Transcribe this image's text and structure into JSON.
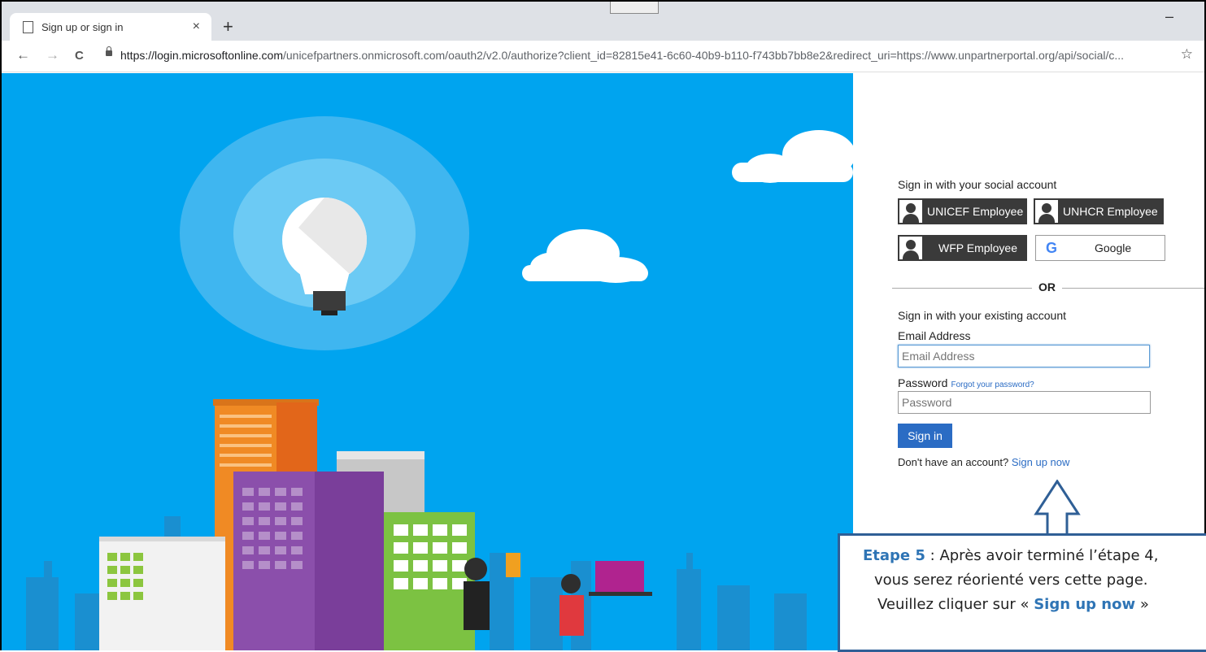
{
  "browser": {
    "tab_title": "Sign up or sign in",
    "tab_close": "×",
    "new_tab": "+",
    "minimize": "–",
    "back": "←",
    "forward": "→",
    "reload": "C",
    "url_host": "https://login.microsoftonline.com",
    "url_rest": "/unicefpartners.onmicrosoft.com/oauth2/v2.0/authorize?client_id=82815e41-6c60-40b9-b110-f743bb7bb8e2&redirect_uri=https://www.unpartnerportal.org/api/social/c...",
    "star": "☆"
  },
  "signin": {
    "social_title": "Sign in with your social account",
    "social_buttons": [
      {
        "label": "UNICEF Employee",
        "icon": "person-icon"
      },
      {
        "label": "UNHCR Employee",
        "icon": "person-icon"
      },
      {
        "label": "WFP Employee",
        "icon": "person-icon"
      },
      {
        "label": "Google",
        "icon": "google-g-icon"
      }
    ],
    "google_glyph": "G",
    "or_label": "OR",
    "existing_title": "Sign in with your existing account",
    "email_label": "Email Address",
    "email_placeholder": "Email Address",
    "password_label": "Password",
    "forgot_link": "Forgot your password?",
    "password_placeholder": "Password",
    "signin_button": "Sign in",
    "no_account_text": "Don't have an account?",
    "signup_link": "Sign up now"
  },
  "annotation": {
    "step": "Etape 5",
    "line1_rest": " : Après avoir terminé l’étape 4,",
    "line2": "vous serez réorienté vers cette page.",
    "line3_start": "Veuillez cliquer sur « ",
    "line3_link": "Sign up now",
    "line3_end": " »"
  },
  "colors": {
    "hero_bg": "#00a4ef",
    "primary_button": "#2b6cc4",
    "social_button": "#3a3a3a",
    "callout_border": "#2f5f96"
  }
}
